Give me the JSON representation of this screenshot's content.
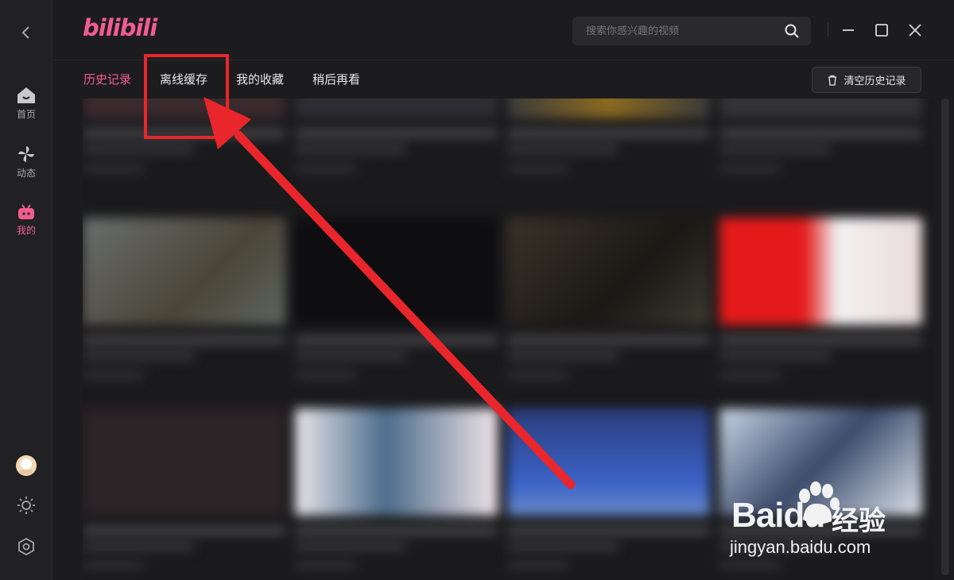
{
  "app": {
    "logo_text": "bilibili",
    "accent": "#f25d8e"
  },
  "rail": {
    "items": [
      {
        "label": "首页",
        "icon": "home-icon"
      },
      {
        "label": "动态",
        "icon": "pinwheel-icon"
      },
      {
        "label": "我的",
        "icon": "tv-icon",
        "active": true
      }
    ],
    "bottom_icons": [
      "avatar",
      "theme-sun-icon",
      "settings-icon"
    ]
  },
  "search": {
    "placeholder": "搜索你感兴趣的视频"
  },
  "tabs": [
    {
      "label": "历史记录",
      "active": true
    },
    {
      "label": "离线缓存"
    },
    {
      "label": "我的收藏"
    },
    {
      "label": "稍后再看"
    }
  ],
  "clear_history_label": "清空历史记录",
  "annotation": {
    "color": "#e8262c",
    "target": "离线缓存"
  },
  "watermark": {
    "brand": "Baidu",
    "suffix": "经验",
    "url": "jingyan.baidu.com"
  }
}
